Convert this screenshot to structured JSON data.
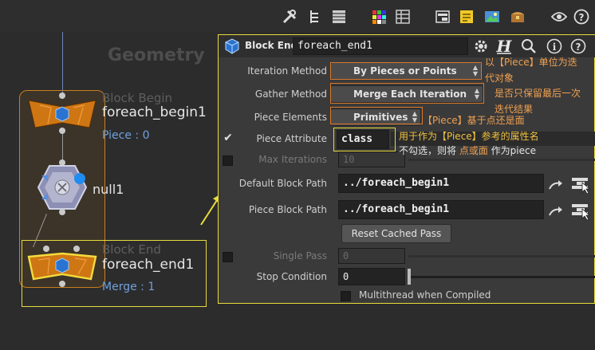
{
  "network": {
    "context_label": "Geometry",
    "block_begin": {
      "type_label": "Block Begin",
      "name": "foreach_begin1",
      "sub": "Piece : 0"
    },
    "null_node": {
      "name": "null1"
    },
    "block_end": {
      "type_label": "Block End",
      "name": "foreach_end1",
      "sub": "Merge : 1"
    }
  },
  "toolbar": {
    "icons": [
      "wrench-icon",
      "tree-icon",
      "list-icon",
      "color-grid-icon",
      "table-icon",
      "panel-icon",
      "note-icon",
      "image-icon",
      "chest-icon",
      "eye-icon",
      "help-icon"
    ]
  },
  "params": {
    "node_type": "Block End",
    "node_name": "foreach_end1",
    "iteration_method": {
      "label": "Iteration Method",
      "value": "By Pieces or Points"
    },
    "gather_method": {
      "label": "Gather Method",
      "value": "Merge Each Iteration"
    },
    "piece_elements": {
      "label": "Piece Elements",
      "value": "Primitives"
    },
    "piece_attribute": {
      "label": "Piece Attribute",
      "value": "class"
    },
    "max_iterations": {
      "label": "Max Iterations",
      "value": "10"
    },
    "default_block_path": {
      "label": "Default Block Path",
      "value": "../foreach_begin1"
    },
    "piece_block_path": {
      "label": "Piece Block Path",
      "value": "../foreach_begin1"
    },
    "reset_button": "Reset Cached Pass",
    "single_pass": {
      "label": "Single Pass",
      "value": "0"
    },
    "stop_condition": {
      "label": "Stop Condition",
      "value": "0"
    },
    "multithread": "Multithread when Compiled"
  },
  "annotations": {
    "iter_note_1": "以【Piece】单位为迭",
    "iter_note_2": "代对象",
    "gather_note_1": "是否只保留最后一次",
    "gather_note_2": "迭代结果",
    "elements_note": "【Piece】基于点还是面",
    "attr_note_1": "用于作为【Piece】参考的属性名",
    "attr_note_2a": "不勾选，则将 ",
    "attr_note_2b": "点或面",
    "attr_note_2c": " 作为piece"
  },
  "colors": {
    "annotation_orange": "#d9782b",
    "highlight_yellow": "#e7dc3c",
    "node_orange": "#c77e1f",
    "sub_blue": "#6fa0dc"
  }
}
